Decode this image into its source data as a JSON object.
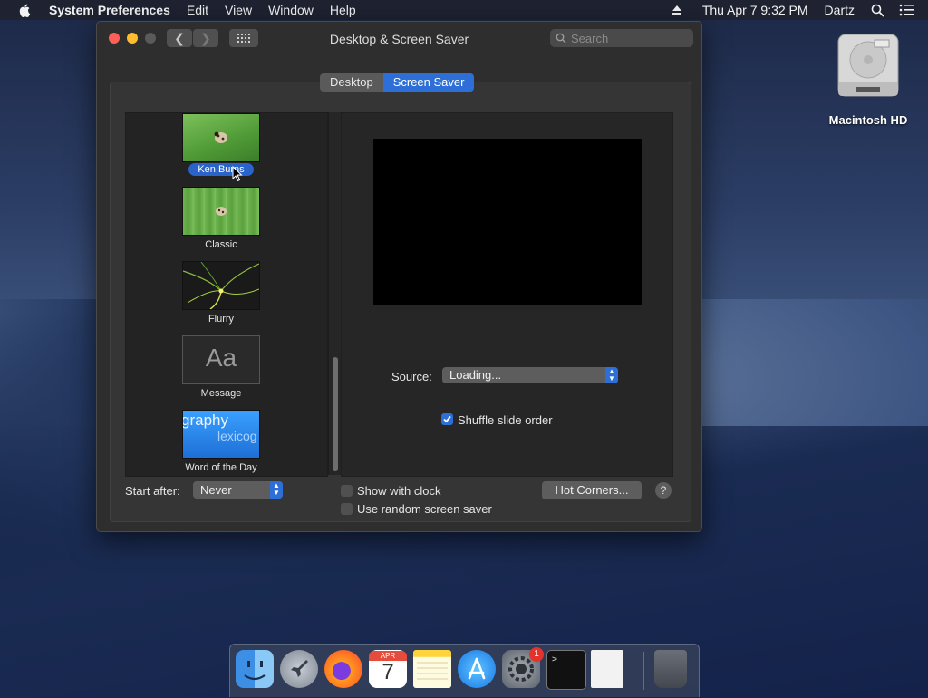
{
  "menubar": {
    "app_name": "System Preferences",
    "menus": [
      "Edit",
      "View",
      "Window",
      "Help"
    ],
    "clock": "Thu Apr 7  9:32 PM",
    "user": "Dartz"
  },
  "window": {
    "title": "Desktop & Screen Saver",
    "search_placeholder": "Search",
    "tabs": [
      "Desktop",
      "Screen Saver"
    ],
    "active_tab": "Screen Saver"
  },
  "savers": [
    {
      "label": "Ken Burns",
      "selected": true
    },
    {
      "label": "Classic",
      "selected": false
    },
    {
      "label": "Flurry",
      "selected": false
    },
    {
      "label": "Message",
      "selected": false
    },
    {
      "label": "Word of the Day",
      "selected": false
    }
  ],
  "message_thumb_text": "Aa",
  "word_thumb_text": "graphy",
  "word_thumb_text2": "lexicog",
  "source": {
    "label": "Source:",
    "value": "Loading..."
  },
  "shuffle": {
    "label": "Shuffle slide order",
    "checked": true
  },
  "start_after": {
    "label": "Start after:",
    "value": "Never"
  },
  "show_clock": {
    "label": "Show with clock",
    "checked": false
  },
  "random_saver": {
    "label": "Use random screen saver",
    "checked": false
  },
  "hot_corners_label": "Hot Corners...",
  "help_label": "?",
  "desktop_icon_label": "Macintosh HD",
  "dock": {
    "calendar_month": "APR",
    "calendar_day": "7",
    "sysprefs_badge": "1",
    "apps": [
      "finder-icon",
      "launchpad-icon",
      "firefox-icon",
      "calendar-icon",
      "notes-icon",
      "app-store-icon",
      "system-preferences-icon",
      "terminal-icon",
      "document-icon",
      "trash-icon"
    ]
  }
}
